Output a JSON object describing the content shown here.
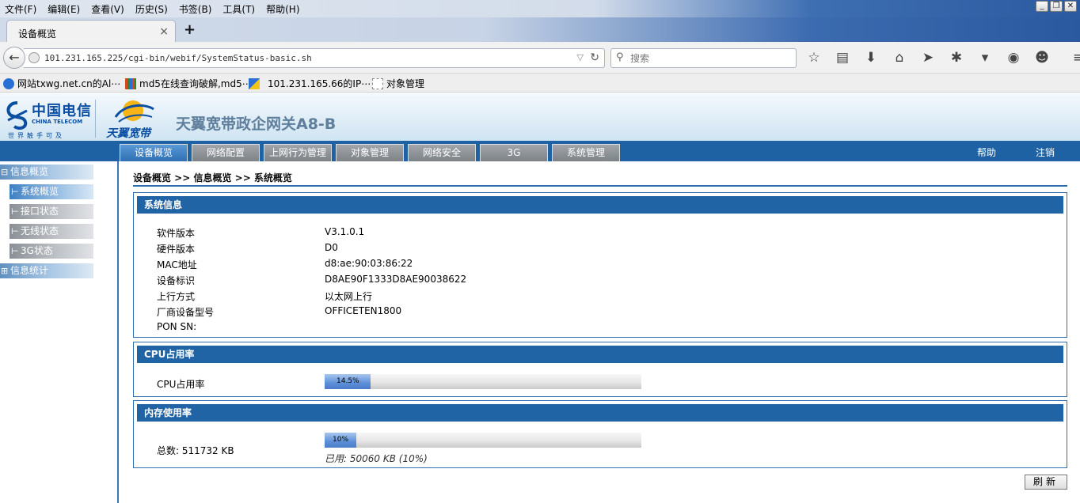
{
  "browser": {
    "menu": [
      "文件(F)",
      "编辑(E)",
      "查看(V)",
      "历史(S)",
      "书签(B)",
      "工具(T)",
      "帮助(H)"
    ],
    "tab_title": "设备概览",
    "url": "101.231.165.225/cgi-bin/webif/SystemStatus-basic.sh",
    "search_placeholder": "搜索",
    "bookmarks": [
      {
        "label": "网站txwg.net.cn的Al⋯",
        "color": "#2a6fd6"
      },
      {
        "label": "md5在线查询破解,md5⋯",
        "color": "#d44a1f"
      },
      {
        "label": "101.231.165.66的IP⋯",
        "color": "#2a6fd6"
      },
      {
        "label": "对象管理",
        "color": "#888888"
      }
    ]
  },
  "header": {
    "ct_logo_cn": "中国电信",
    "ct_logo_en": "CHINA TELECOM",
    "ct_slogan": "世界触手可及",
    "ty_logo": "天翼宽带",
    "product": "天翼宽带政企网关A8-B"
  },
  "nav": {
    "tabs": [
      "设备概览",
      "网络配置",
      "上网行为管理",
      "对象管理",
      "网络安全",
      "3G",
      "系统管理"
    ],
    "active": 0,
    "help": "帮助",
    "logout": "注销"
  },
  "sidebar": {
    "info_overview": "信息概览",
    "items": [
      "系统概览",
      "接口状态",
      "无线状态",
      "3G状态"
    ],
    "selected": 0,
    "info_stats": "信息统计"
  },
  "breadcrumb": "设备概览 >> 信息概览 >> 系统概览",
  "system_info": {
    "title": "系统信息",
    "rows": [
      {
        "key": "软件版本",
        "value": "V3.1.0.1"
      },
      {
        "key": "硬件版本",
        "value": "D0"
      },
      {
        "key": "MAC地址",
        "value": "d8:ae:90:03:86:22"
      },
      {
        "key": "设备标识",
        "value": "D8AE90F1333D8AE90038622"
      },
      {
        "key": "上行方式",
        "value": "以太网上行"
      },
      {
        "key": "厂商设备型号",
        "value": "OFFICETEN1800"
      },
      {
        "key": "PON SN:",
        "value": ""
      }
    ]
  },
  "cpu": {
    "title": "CPU占用率",
    "label": "CPU占用率",
    "percent": 14.5,
    "percent_text": "14.5%"
  },
  "memory": {
    "title": "内存使用率",
    "total": "总数: 511732 KB",
    "percent": 10,
    "percent_text": "10%",
    "used": "已用: 50060 KB (10%)"
  },
  "refresh_label": "刷新"
}
